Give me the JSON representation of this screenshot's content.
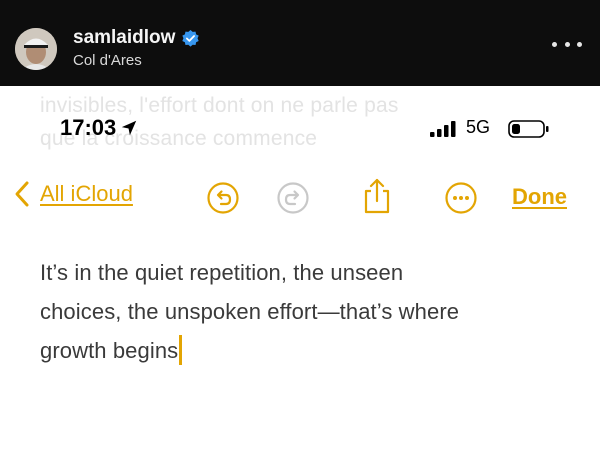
{
  "post_header": {
    "username": "samlaidlow",
    "location": "Col d'Ares"
  },
  "ghost_text": {
    "line1": "invisibles, l'effort dont on ne parle pas",
    "line2": "que la croissance commence"
  },
  "status_bar": {
    "time": "17:03",
    "network": "5G"
  },
  "toolbar": {
    "back_label": "All iCloud",
    "done_label": "Done"
  },
  "note": {
    "line1": "It’s in the quiet repetition, the unseen",
    "line2": "choices, the unspoken effort—that’s where",
    "line3": "growth begins"
  },
  "colors": {
    "accent": "#e3a503",
    "header_bg": "#0d0d0d",
    "verified": "#3797f0"
  },
  "icons": [
    "verified-badge-icon",
    "more-options-icon",
    "location-arrow-icon",
    "signal-icon",
    "battery-icon",
    "chevron-left-icon",
    "undo-icon",
    "redo-icon",
    "share-icon",
    "ellipsis-circle-icon"
  ]
}
